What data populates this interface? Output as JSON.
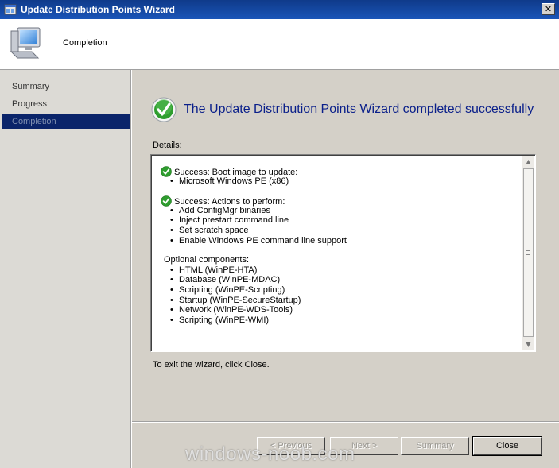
{
  "window": {
    "title": "Update Distribution Points Wizard",
    "close_glyph": "✕"
  },
  "header": {
    "heading": "Completion",
    "icon": "computer-icon"
  },
  "sidebar": {
    "items": [
      {
        "label": "Summary",
        "active": false
      },
      {
        "label": "Progress",
        "active": false
      },
      {
        "label": "Completion",
        "active": true
      }
    ]
  },
  "main": {
    "success_message": "The Update Distribution Points Wizard completed successfully",
    "details_label": "Details:",
    "details": {
      "section1": {
        "heading": "Success: Boot image to update:",
        "items": [
          "Microsoft Windows PE (x86)"
        ]
      },
      "section2": {
        "heading": "Success: Actions to perform:",
        "items": [
          "Add ConfigMgr binaries",
          "Inject prestart command line",
          "Set scratch space",
          "Enable Windows PE command line support"
        ]
      },
      "section3": {
        "heading": "Optional components:",
        "items": [
          "HTML (WinPE-HTA)",
          "Database (WinPE-MDAC)",
          "Scripting (WinPE-Scripting)",
          "Startup (WinPE-SecureStartup)",
          "Network (WinPE-WDS-Tools)",
          "Scripting (WinPE-WMI)"
        ]
      }
    },
    "exit_text": "To exit the wizard, click Close."
  },
  "buttons": {
    "previous": "< Previous",
    "next": "Next >",
    "summary": "Summary",
    "close": "Close"
  },
  "watermark": "windows-noob.com",
  "colors": {
    "title_bar": "#1a55b8",
    "success_text": "#0a1f8a",
    "sidebar_active": "#0a246a",
    "success_green": "#2e9d2e"
  }
}
